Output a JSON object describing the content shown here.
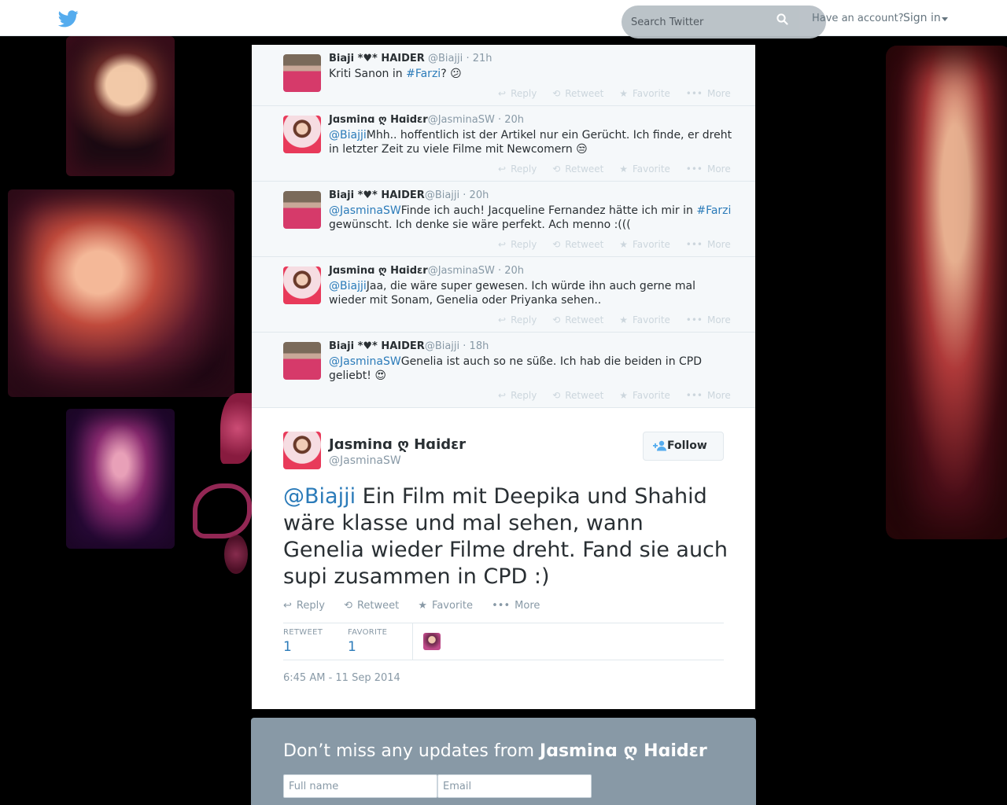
{
  "topbar": {
    "search_placeholder": "Search Twitter",
    "have_account": "Have an account?",
    "sign_in": "Sign in"
  },
  "replies": [
    {
      "name": "Biaji *♥* HAIDER",
      "handle": "@Biajji",
      "time": "· 21h",
      "text_before": "Kriti Sanon in ",
      "link": "#Farzi",
      "text_after": "? 😕",
      "mention": ""
    },
    {
      "name": "Jɑsminɑ ღ Hɑidɛr",
      "handle": "@JasminaSW",
      "time": "· 20h",
      "mention": "@Biajji",
      "text": "Mhh.. hoffentlich ist der Artikel nur ein Gerücht. Ich finde, er dreht in letzter Zeit zu viele Filme mit Newcomern 😒"
    },
    {
      "name": "Biaji *♥* HAIDER",
      "handle": "@Biajji",
      "time": "· 20h",
      "mention": "@JasminaSW",
      "text_before": "Finde ich auch! Jacqueline Fernandez hätte ich mir in ",
      "link": "#Farzi",
      "text_after": " gewünscht. Ich denke sie wäre perfekt. Ach menno :((("
    },
    {
      "name": "Jɑsminɑ ღ Hɑidɛr",
      "handle": "@JasminaSW",
      "time": "· 20h",
      "mention": "@Biajji",
      "text": "Jaa, die wäre super gewesen. Ich würde ihn auch gerne mal wieder mit Sonam, Genelia oder Priyanka sehen.."
    },
    {
      "name": "Biaji *♥* HAIDER",
      "handle": "@Biajji",
      "time": "· 18h",
      "mention": "@JasminaSW",
      "text": "Genelia ist auch so ne süße. Ich hab die beiden in CPD geliebt! 😍"
    }
  ],
  "actions": {
    "reply": "Reply",
    "retweet": "Retweet",
    "favorite": "Favorite",
    "more": "More"
  },
  "permalink": {
    "name": "Jɑsminɑ ღ Hɑidɛr",
    "handle": "@JasminaSW",
    "follow": "Follow",
    "mention": "@Biajji",
    "text": " Ein Film mit Deepika und Shahid wäre klasse und mal sehen, wann Genelia wieder Filme dreht. Fand sie auch supi zusammen in CPD :)",
    "stats": {
      "retweet_label": "RETWEET",
      "retweet_count": "1",
      "favorite_label": "FAVORITE",
      "favorite_count": "1"
    },
    "date": "6:45 AM - 11 Sep 2014"
  },
  "signup": {
    "title_prefix": "Don’t miss any updates from ",
    "title_name": "Jɑsminɑ ღ Hɑidɛr",
    "fullname_placeholder": "Full name",
    "email_placeholder": "Email"
  },
  "colors": {
    "link": "#2b7bb9",
    "twitter_blue": "#55acee",
    "muted": "#8899a6"
  }
}
